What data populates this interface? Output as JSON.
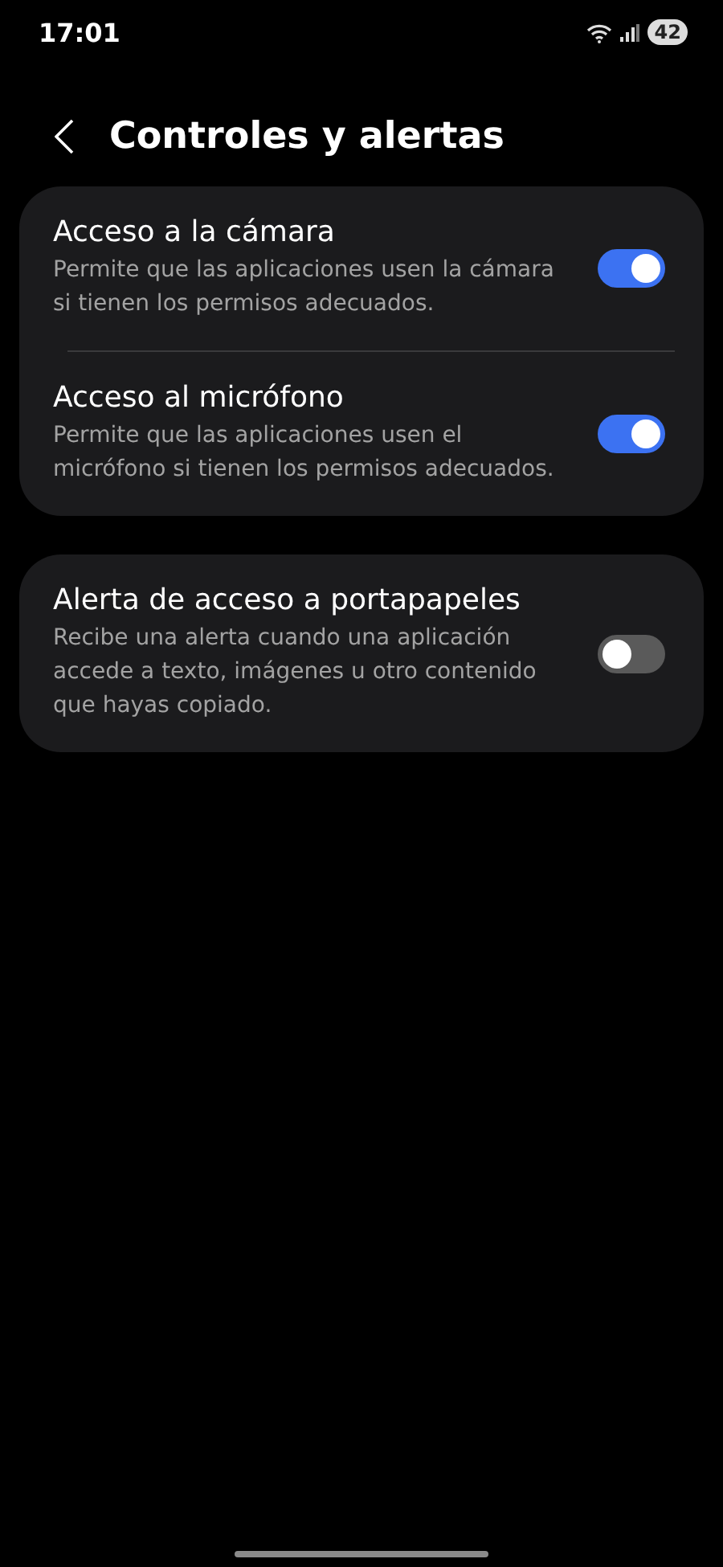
{
  "status_bar": {
    "time": "17:01",
    "battery": "42"
  },
  "header": {
    "title": "Controles y alertas"
  },
  "cards": [
    {
      "items": [
        {
          "title": "Acceso a la cámara",
          "description": "Permite que las aplicaciones usen la cámara si tienen los permisos adecuados.",
          "on": true
        },
        {
          "title": "Acceso al micrófono",
          "description": "Permite que las aplicaciones usen el micrófono si tienen los permisos adecuados.",
          "on": true
        }
      ]
    },
    {
      "items": [
        {
          "title": "Alerta de acceso a portapapeles",
          "description": "Recibe una alerta cuando una aplicación accede a texto, imágenes u otro contenido que hayas copiado.",
          "on": false
        }
      ]
    }
  ]
}
